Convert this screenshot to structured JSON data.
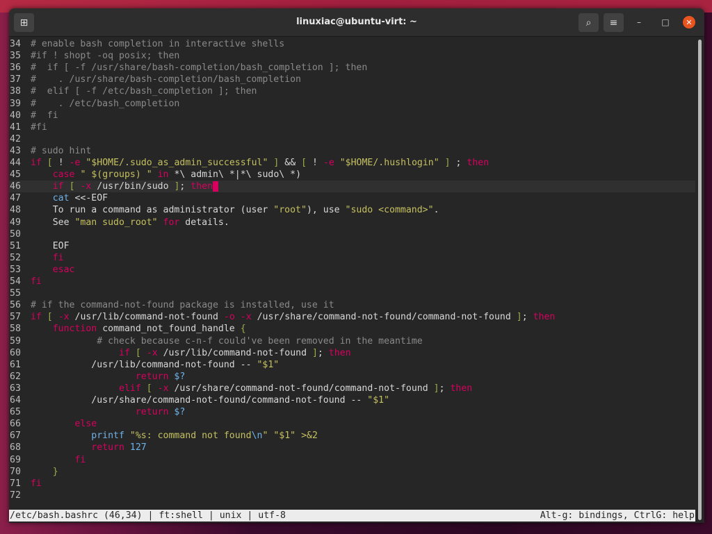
{
  "window": {
    "title": "linuxiac@ubuntu-virt: ~",
    "buttons": {
      "new_tab_icon": "⊞",
      "search_icon": "⌕",
      "menu_icon": "≡",
      "minimize_icon": "–",
      "maximize_icon": "□",
      "close_icon": "✕"
    }
  },
  "editor": {
    "current_line": 46,
    "lines": [
      {
        "n": "34",
        "segs": [
          {
            "t": "# enable bash completion in interactive shells",
            "c": "comment"
          }
        ]
      },
      {
        "n": "35",
        "segs": [
          {
            "t": "#if ! shopt -oq posix; then",
            "c": "comment"
          }
        ]
      },
      {
        "n": "36",
        "segs": [
          {
            "t": "#  if [ -f /usr/share/bash-completion/bash_completion ]; then",
            "c": "comment"
          }
        ]
      },
      {
        "n": "37",
        "segs": [
          {
            "t": "#    . /usr/share/bash-completion/bash_completion",
            "c": "comment"
          }
        ]
      },
      {
        "n": "38",
        "segs": [
          {
            "t": "#  elif [ -f /etc/bash_completion ]; then",
            "c": "comment"
          }
        ]
      },
      {
        "n": "39",
        "segs": [
          {
            "t": "#    . /etc/bash_completion",
            "c": "comment"
          }
        ]
      },
      {
        "n": "40",
        "segs": [
          {
            "t": "#  fi",
            "c": "comment"
          }
        ]
      },
      {
        "n": "41",
        "segs": [
          {
            "t": "#fi",
            "c": "comment"
          }
        ]
      },
      {
        "n": "42",
        "segs": []
      },
      {
        "n": "43",
        "segs": [
          {
            "t": "# sudo hint",
            "c": "comment"
          }
        ]
      },
      {
        "n": "44",
        "segs": [
          {
            "t": "if",
            "c": "kw"
          },
          {
            "t": " "
          },
          {
            "t": "[",
            "c": "brk"
          },
          {
            "t": " ! "
          },
          {
            "t": "-e",
            "c": "opt"
          },
          {
            "t": " "
          },
          {
            "t": "\"$HOME/.sudo_as_admin_successful\"",
            "c": "str"
          },
          {
            "t": " "
          },
          {
            "t": "]",
            "c": "brk"
          },
          {
            "t": " && "
          },
          {
            "t": "[",
            "c": "brk"
          },
          {
            "t": " ! "
          },
          {
            "t": "-e",
            "c": "opt"
          },
          {
            "t": " "
          },
          {
            "t": "\"$HOME/.hushlogin\"",
            "c": "str"
          },
          {
            "t": " "
          },
          {
            "t": "]",
            "c": "brk"
          },
          {
            "t": " ; "
          },
          {
            "t": "then",
            "c": "kw"
          }
        ]
      },
      {
        "n": "45",
        "segs": [
          {
            "t": "    "
          },
          {
            "t": "case",
            "c": "kw"
          },
          {
            "t": " "
          },
          {
            "t": "\" $(groups) \"",
            "c": "str"
          },
          {
            "t": " "
          },
          {
            "t": "in",
            "c": "kw"
          },
          {
            "t": " *\\ admin\\ *|*\\ sudo\\ *)"
          }
        ]
      },
      {
        "n": "46",
        "segs": [
          {
            "t": "    "
          },
          {
            "t": "if",
            "c": "kw"
          },
          {
            "t": " "
          },
          {
            "t": "[",
            "c": "brk"
          },
          {
            "t": " "
          },
          {
            "t": "-x",
            "c": "opt"
          },
          {
            "t": " /usr/bin/sudo "
          },
          {
            "t": "]",
            "c": "brk"
          },
          {
            "t": "; "
          },
          {
            "t": "then",
            "c": "kw"
          },
          {
            "t": " ",
            "c": "cursor"
          }
        ]
      },
      {
        "n": "47",
        "segs": [
          {
            "t": "    "
          },
          {
            "t": "cat",
            "c": "cmd"
          },
          {
            "t": " <<-EOF"
          }
        ]
      },
      {
        "n": "48",
        "segs": [
          {
            "t": "    To run a command as administrator (user "
          },
          {
            "t": "\"root\"",
            "c": "str"
          },
          {
            "t": "), use "
          },
          {
            "t": "\"sudo <command>\"",
            "c": "str"
          },
          {
            "t": "."
          }
        ]
      },
      {
        "n": "49",
        "segs": [
          {
            "t": "    See "
          },
          {
            "t": "\"man sudo_root\"",
            "c": "str"
          },
          {
            "t": " "
          },
          {
            "t": "for",
            "c": "kw"
          },
          {
            "t": " details."
          }
        ]
      },
      {
        "n": "50",
        "segs": []
      },
      {
        "n": "51",
        "segs": [
          {
            "t": "    EOF"
          }
        ]
      },
      {
        "n": "52",
        "segs": [
          {
            "t": "    "
          },
          {
            "t": "fi",
            "c": "kw"
          }
        ]
      },
      {
        "n": "53",
        "segs": [
          {
            "t": "    "
          },
          {
            "t": "esac",
            "c": "kw"
          }
        ]
      },
      {
        "n": "54",
        "segs": [
          {
            "t": "fi",
            "c": "kw"
          }
        ]
      },
      {
        "n": "55",
        "segs": []
      },
      {
        "n": "56",
        "segs": [
          {
            "t": "# if the command-not-found package is installed, use it",
            "c": "comment"
          }
        ]
      },
      {
        "n": "57",
        "segs": [
          {
            "t": "if",
            "c": "kw"
          },
          {
            "t": " "
          },
          {
            "t": "[",
            "c": "brk"
          },
          {
            "t": " "
          },
          {
            "t": "-x",
            "c": "opt"
          },
          {
            "t": " /usr/lib/command-not-found "
          },
          {
            "t": "-o",
            "c": "opt"
          },
          {
            "t": " "
          },
          {
            "t": "-x",
            "c": "opt"
          },
          {
            "t": " /usr/share/command-not-found/command-not-found "
          },
          {
            "t": "]",
            "c": "brk"
          },
          {
            "t": "; "
          },
          {
            "t": "then",
            "c": "kw"
          }
        ]
      },
      {
        "n": "58",
        "segs": [
          {
            "t": "    "
          },
          {
            "t": "function",
            "c": "kw"
          },
          {
            "t": " command_not_found_handle "
          },
          {
            "t": "{",
            "c": "brk"
          }
        ]
      },
      {
        "n": "59",
        "segs": [
          {
            "t": "            "
          },
          {
            "t": "# check because c-n-f could've been removed in the meantime",
            "c": "comment"
          }
        ]
      },
      {
        "n": "60",
        "segs": [
          {
            "t": "                "
          },
          {
            "t": "if",
            "c": "kw"
          },
          {
            "t": " "
          },
          {
            "t": "[",
            "c": "brk"
          },
          {
            "t": " "
          },
          {
            "t": "-x",
            "c": "opt"
          },
          {
            "t": " /usr/lib/command-not-found "
          },
          {
            "t": "]",
            "c": "brk"
          },
          {
            "t": "; "
          },
          {
            "t": "then",
            "c": "kw"
          }
        ]
      },
      {
        "n": "61",
        "segs": [
          {
            "t": "           /usr/lib/command-not-found -- "
          },
          {
            "t": "\"$1\"",
            "c": "str"
          }
        ]
      },
      {
        "n": "62",
        "segs": [
          {
            "t": "                   "
          },
          {
            "t": "return",
            "c": "kw"
          },
          {
            "t": " "
          },
          {
            "t": "$?",
            "c": "var"
          }
        ]
      },
      {
        "n": "63",
        "segs": [
          {
            "t": "                "
          },
          {
            "t": "elif",
            "c": "kw"
          },
          {
            "t": " "
          },
          {
            "t": "[",
            "c": "brk"
          },
          {
            "t": " "
          },
          {
            "t": "-x",
            "c": "opt"
          },
          {
            "t": " /usr/share/command-not-found/command-not-found "
          },
          {
            "t": "]",
            "c": "brk"
          },
          {
            "t": "; "
          },
          {
            "t": "then",
            "c": "kw"
          }
        ]
      },
      {
        "n": "64",
        "segs": [
          {
            "t": "           /usr/share/command-not-found/command-not-found -- "
          },
          {
            "t": "\"$1\"",
            "c": "str"
          }
        ]
      },
      {
        "n": "65",
        "segs": [
          {
            "t": "                   "
          },
          {
            "t": "return",
            "c": "kw"
          },
          {
            "t": " "
          },
          {
            "t": "$?",
            "c": "var"
          }
        ]
      },
      {
        "n": "66",
        "segs": [
          {
            "t": "        "
          },
          {
            "t": "else",
            "c": "kw"
          }
        ]
      },
      {
        "n": "67",
        "segs": [
          {
            "t": "           "
          },
          {
            "t": "printf",
            "c": "cmd"
          },
          {
            "t": " "
          },
          {
            "t": "\"%s: command not found",
            "c": "str"
          },
          {
            "t": "\\n",
            "c": "var"
          },
          {
            "t": "\"",
            "c": "str"
          },
          {
            "t": " "
          },
          {
            "t": "\"$1\"",
            "c": "str"
          },
          {
            "t": " "
          },
          {
            "t": ">&2",
            "c": "str"
          }
        ]
      },
      {
        "n": "68",
        "segs": [
          {
            "t": "           "
          },
          {
            "t": "return",
            "c": "kw"
          },
          {
            "t": " "
          },
          {
            "t": "127",
            "c": "num"
          }
        ]
      },
      {
        "n": "69",
        "segs": [
          {
            "t": "        "
          },
          {
            "t": "fi",
            "c": "kw"
          }
        ]
      },
      {
        "n": "70",
        "segs": [
          {
            "t": "    "
          },
          {
            "t": "}",
            "c": "brk"
          }
        ]
      },
      {
        "n": "71",
        "segs": [
          {
            "t": "fi",
            "c": "kw"
          }
        ]
      },
      {
        "n": "72",
        "segs": []
      }
    ]
  },
  "statusbar": {
    "left": "/etc/bash.bashrc (46,34) | ft:shell | unix | utf-8",
    "right": "Alt-g: bindings, CtrlG: help"
  }
}
